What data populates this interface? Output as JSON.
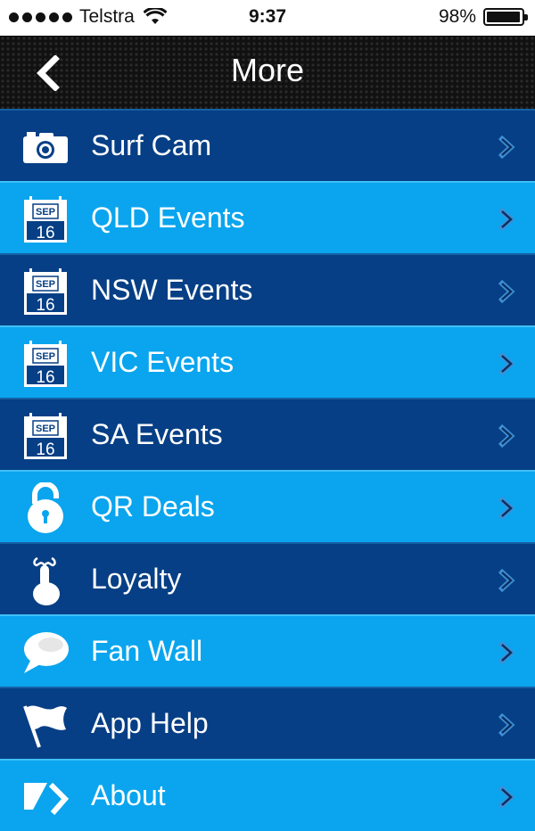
{
  "status": {
    "carrier": "Telstra",
    "time": "9:37",
    "battery": "98%",
    "battery_level": 0.98
  },
  "nav": {
    "title": "More"
  },
  "calendar_icon": {
    "month": "SEP",
    "day": "16"
  },
  "items": [
    {
      "label": "Surf Cam",
      "icon": "camera-icon"
    },
    {
      "label": "QLD Events",
      "icon": "calendar-icon"
    },
    {
      "label": "NSW Events",
      "icon": "calendar-icon"
    },
    {
      "label": "VIC Events",
      "icon": "calendar-icon"
    },
    {
      "label": "SA Events",
      "icon": "calendar-icon"
    },
    {
      "label": "QR Deals",
      "icon": "padlock-icon"
    },
    {
      "label": "Loyalty",
      "icon": "finger-ribbon-icon"
    },
    {
      "label": "Fan Wall",
      "icon": "speech-bubble-icon"
    },
    {
      "label": "App Help",
      "icon": "flag-icon"
    },
    {
      "label": "About",
      "icon": "about-icon"
    }
  ],
  "colors": {
    "row_dark": "#063f85",
    "row_light": "#0aa5ee",
    "nav_bg": "#111111"
  }
}
